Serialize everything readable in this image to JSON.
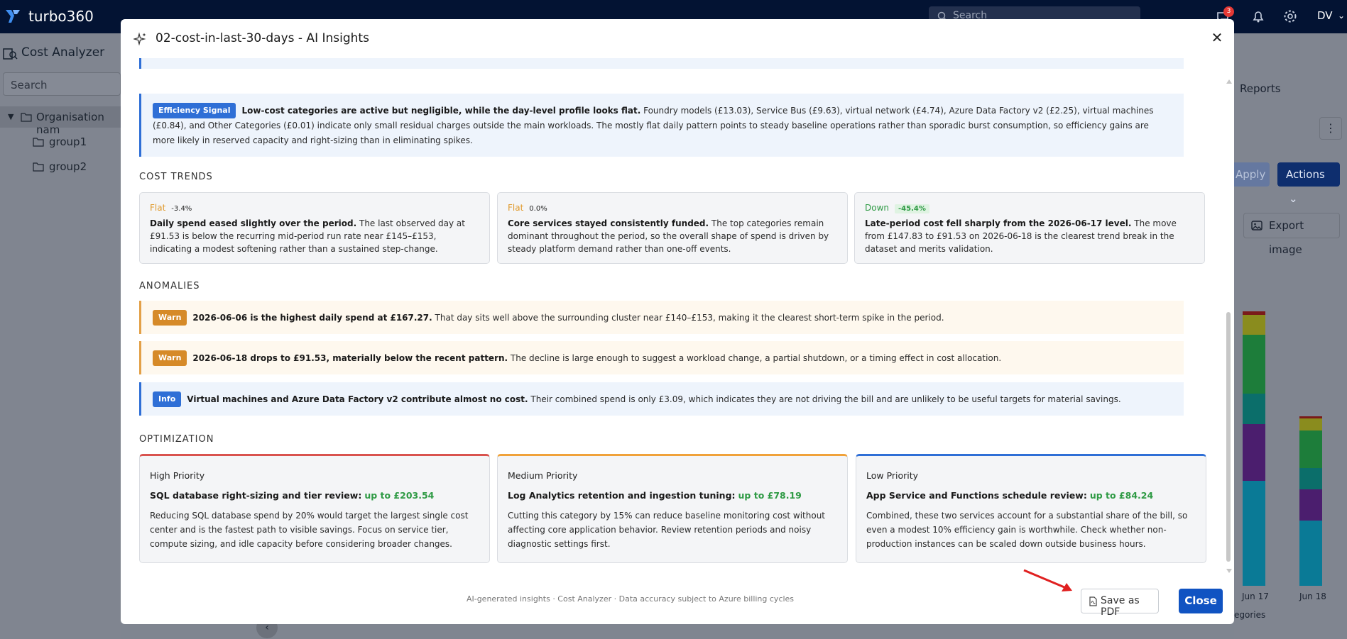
{
  "app": {
    "brand": "turbo360",
    "search_placeholder": "Search",
    "notification_count": "3",
    "user_initials": "DV",
    "page_title": "Cost Analyzer",
    "sidebar_search_placeholder": "Search",
    "tree": {
      "root": "Organisation nam",
      "children": [
        "group1",
        "group2"
      ]
    },
    "reports_tab": "Reports",
    "apply_label": "Apply",
    "actions_label": "Actions",
    "export_label": "Export image",
    "chart": {
      "x_labels": [
        "Jun 17",
        "Jun 18"
      ],
      "legend_fragment": "egories",
      "series_colors": [
        "#0a7a96",
        "#4b1e6e",
        "#0b6e6a",
        "#1d7d3a",
        "#8a8c1e",
        "#7a1a1a"
      ]
    }
  },
  "modal": {
    "title": "02-cost-in-last-30-days - AI Insights",
    "efficiency": {
      "badge": "Efficiency Signal",
      "headline": "Low-cost categories are active but negligible, while the day-level profile looks flat.",
      "body": "Foundry models (£13.03), Service Bus (£9.63), virtual network (£4.74), Azure Data Factory v2 (£2.25), virtual machines (£0.84), and Other Categories (£0.01) indicate only small residual charges outside the main workloads. The mostly flat daily pattern points to steady baseline operations rather than sporadic burst consumption, so efficiency gains are more likely in reserved capacity and right-sizing than in eliminating spikes."
    },
    "cost_trends": {
      "title": "COST TRENDS",
      "cards": [
        {
          "direction": "Flat",
          "pct": "-3.4%",
          "headline": "Daily spend eased slightly over the period.",
          "body": "The last observed day at £91.53 is below the recurring mid-period run rate near £145–£153, indicating a modest softening rather than a sustained step-change."
        },
        {
          "direction": "Flat",
          "pct": "0.0%",
          "headline": "Core services stayed consistently funded.",
          "body": "The top categories remain dominant throughout the period, so the overall shape of spend is driven by steady platform demand rather than one-off events."
        },
        {
          "direction": "Down",
          "pct": "-45.4%",
          "headline": "Late-period cost fell sharply from the 2026-06-17 level.",
          "body": "The move from £147.83 to £91.53 on 2026-06-18 is the clearest trend break in the dataset and merits validation."
        }
      ]
    },
    "anomalies": {
      "title": "ANOMALIES",
      "items": [
        {
          "badge": "Warn",
          "headline": "2026-06-06 is the highest daily spend at £167.27.",
          "body": "That day sits well above the surrounding cluster near £140–£153, making it the clearest short-term spike in the period."
        },
        {
          "badge": "Warn",
          "headline": "2026-06-18 drops to £91.53, materially below the recent pattern.",
          "body": "The decline is large enough to suggest a workload change, a partial shutdown, or a timing effect in cost allocation."
        },
        {
          "badge": "Info",
          "headline": "Virtual machines and Azure Data Factory v2 contribute almost no cost.",
          "body": "Their combined spend is only £3.09, which indicates they are not driving the bill and are unlikely to be useful targets for material savings."
        }
      ]
    },
    "optimization": {
      "title": "OPTIMIZATION",
      "cards": [
        {
          "priority": "High Priority",
          "headline": "SQL database right-sizing and tier review:",
          "saving": "up to £203.54",
          "body": "Reducing SQL database spend by 20% would target the largest single cost center and is the fastest path to visible savings. Focus on service tier, compute sizing, and idle capacity before considering broader changes."
        },
        {
          "priority": "Medium Priority",
          "headline": "Log Analytics retention and ingestion tuning:",
          "saving": "up to £78.19",
          "body": "Cutting this category by 15% can reduce baseline monitoring cost without affecting core application behavior. Review retention periods and noisy diagnostic settings first."
        },
        {
          "priority": "Low Priority",
          "headline": "App Service and Functions schedule review:",
          "saving": "up to £84.24",
          "body": "Combined, these two services account for a substantial share of the bill, so even a modest 10% efficiency gain is worthwhile. Check whether non-production instances can be scaled down outside business hours."
        }
      ]
    },
    "footer_note": "AI-generated insights · Cost Analyzer · Data accuracy subject to Azure billing cycles",
    "save_pdf_label": "Save as PDF",
    "close_label": "Close"
  }
}
